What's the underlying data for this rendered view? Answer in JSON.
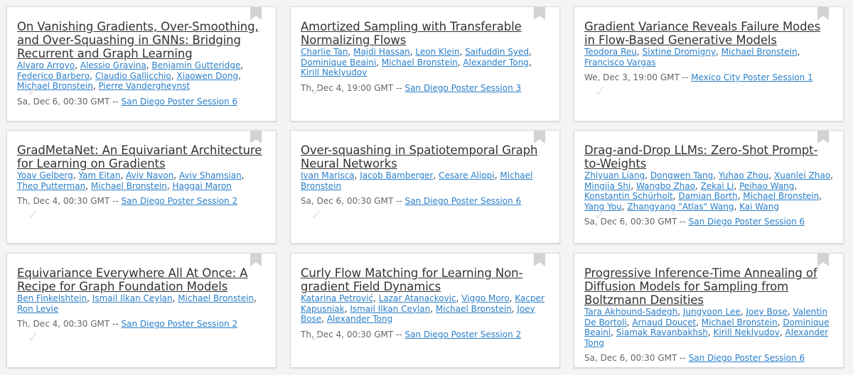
{
  "papers": [
    {
      "title": "On Vanishing Gradients, Over-Smoothing, and Over-Squashing in GNNs: Bridging Recurrent and Graph Learning",
      "authors": [
        "Alvaro Arroyo",
        "Alessio Gravina",
        "Benjamin Gutteridge",
        "Federico Barbero",
        "Claudio Gallicchio",
        "Xiaowen Dong",
        "Michael Bronstein",
        "Pierre Vandergheynst"
      ],
      "time": "Sa, Dec 6, 00:30 GMT --",
      "session": "San Diego Poster Session 6"
    },
    {
      "title": "Amortized Sampling with Transferable Normalizing Flows",
      "authors": [
        "Charlie Tan",
        "Majdi Hassan",
        "Leon Klein",
        "Saifuddin Syed",
        "Dominique Beaini",
        "Michael Bronstein",
        "Alexander Tong",
        "Kirill Neklyudov"
      ],
      "time": "Th, Dec 4, 19:00 GMT --",
      "session": "San Diego Poster Session 3"
    },
    {
      "title": "Gradient Variance Reveals Failure Modes in Flow-Based Generative Models",
      "authors": [
        "Teodora Reu",
        "Sixtine Dromigny",
        "Michael Bronstein",
        "Francisco Vargas"
      ],
      "time": "We, Dec 3, 19:00 GMT --",
      "session": "Mexico City Poster Session 1"
    },
    {
      "title": "GradMetaNet: An Equivariant Architecture for Learning on Gradients",
      "authors": [
        "Yoav Gelberg",
        "Yam Eitan",
        "Aviv Navon",
        "Aviv Shamsian",
        "Theo Putterman",
        "Michael Bronstein",
        "Haggai Maron"
      ],
      "time": "Th, Dec 4, 00:30 GMT --",
      "session": "San Diego Poster Session 2"
    },
    {
      "title": "Over-squashing in Spatiotemporal Graph Neural Networks",
      "authors": [
        "Ivan Marisca",
        "Jacob Bamberger",
        "Cesare Alippi",
        "Michael Bronstein"
      ],
      "time": "Sa, Dec 6, 00:30 GMT --",
      "session": "San Diego Poster Session 6"
    },
    {
      "title": "Drag-and-Drop LLMs: Zero-Shot Prompt-to-Weights",
      "authors": [
        "Zhiyuan Liang",
        "Dongwen Tang",
        "Yuhao Zhou",
        "Xuanlei Zhao",
        "Mingjia Shi",
        "Wangbo Zhao",
        "Zekai Li",
        "Peihao Wang",
        "Konstantin Schürholt",
        "Damian Borth",
        "Michael Bronstein",
        "Yang You",
        "Zhangyang \"Atlas\" Wang",
        "Kai Wang"
      ],
      "time": "Sa, Dec 6, 00:30 GMT --",
      "session": "San Diego Poster Session 6"
    },
    {
      "title": "Equivariance Everywhere All At Once: A Recipe for Graph Foundation Models",
      "authors": [
        "Ben Finkelshtein",
        "Ismail Ilkan Ceylan",
        "Michael Bronstein",
        "Ron Levie"
      ],
      "time": "Th, Dec 4, 00:30 GMT --",
      "session": "San Diego Poster Session 2"
    },
    {
      "title": "Curly Flow Matching for Learning Non-gradient Field Dynamics",
      "authors": [
        "Katarina Petrović",
        "Lazar Atanackovic",
        "Viggo Moro",
        "Kacper Kapusniak",
        "Ismail Ilkan Ceylan",
        "Michael Bronstein",
        "Joey Bose",
        "Alexander Tong"
      ],
      "time": "Th, Dec 4, 00:30 GMT --",
      "session": "San Diego Poster Session 2"
    },
    {
      "title": "Progressive Inference-Time Annealing of Diffusion Models for Sampling from Boltzmann Densities",
      "authors": [
        "Tara Akhound-Sadegh",
        "Jungyoon Lee",
        "Joey Bose",
        "Valentin De Bortoli",
        "Arnaud Doucet",
        "Michael Bronstein",
        "Dominique Beaini",
        "Siamak Ravanbakhsh",
        "Kirill Neklyudov",
        "Alexander Tong"
      ],
      "time": "Sa, Dec 6, 00:30 GMT --",
      "session": "San Diego Poster Session 6"
    }
  ],
  "icons": {
    "bookmark": "bookmark-icon",
    "check": "checkmark-icon"
  },
  "colors": {
    "link": "#2a7fc9",
    "bookmark": "#d3d3d3",
    "card_bg": "#ffffff",
    "page_bg": "#f4f4f4"
  }
}
